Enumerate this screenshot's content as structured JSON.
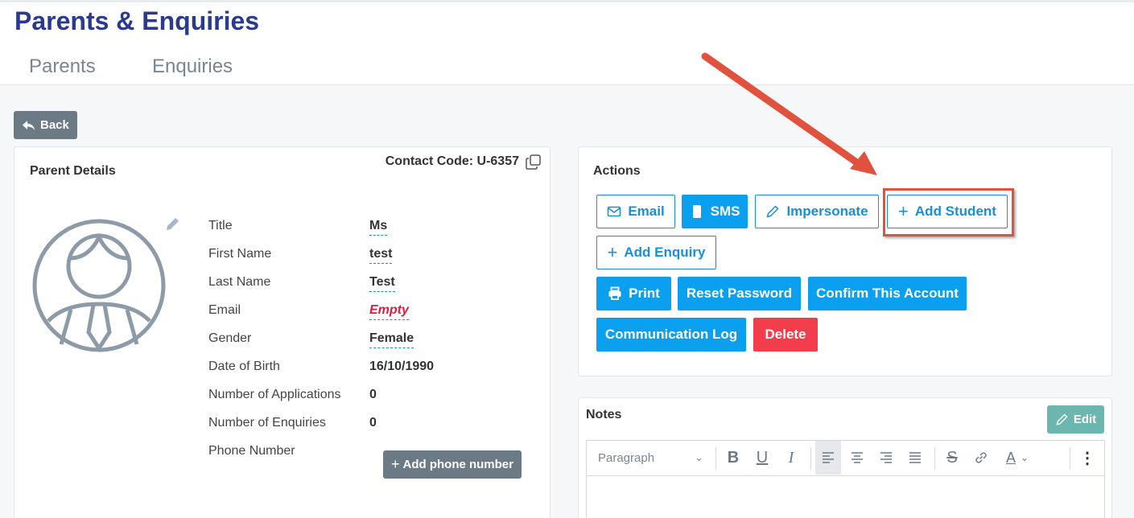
{
  "header": {
    "title": "Parents & Enquiries",
    "tabs": [
      {
        "label": "Parents"
      },
      {
        "label": "Enquiries"
      }
    ]
  },
  "back_button": {
    "label": "Back",
    "icon": "reply-arrow-icon"
  },
  "parent_details": {
    "title": "Parent Details",
    "contact_code": "Contact Code: U-6357",
    "fields": [
      {
        "label": "Title",
        "value": "Ms"
      },
      {
        "label": "First Name",
        "value": "test"
      },
      {
        "label": "Last Name",
        "value": "Test"
      },
      {
        "label": "Email",
        "value": "Empty"
      },
      {
        "label": "Gender",
        "value": "Female"
      },
      {
        "label": "Date of Birth",
        "value": "16/10/1990"
      },
      {
        "label": "Number of Applications",
        "value": "0"
      },
      {
        "label": "Number of Enquiries",
        "value": "0"
      },
      {
        "label": "Phone Number",
        "value": ""
      }
    ],
    "add_phone_label": "Add phone number"
  },
  "actions": {
    "title": "Actions",
    "buttons": {
      "email": "Email",
      "sms": "SMS",
      "impersonate": "Impersonate",
      "add_student": "Add Student",
      "add_enquiry": "Add Enquiry",
      "print": "Print",
      "reset_password": "Reset Password",
      "confirm_account": "Confirm This Account",
      "communication_log": "Communication Log",
      "delete": "Delete"
    }
  },
  "notes": {
    "title": "Notes",
    "edit_label": "Edit",
    "toolbar": {
      "paragraph_select": "Paragraph"
    }
  },
  "colors": {
    "title_blue": "#2a3a8c",
    "primary": "#0ba0ef",
    "danger": "#f23d4d",
    "annotation_red": "#e0523e",
    "muted_button": "#6c7a86",
    "teal_button": "#6cb6b0"
  }
}
